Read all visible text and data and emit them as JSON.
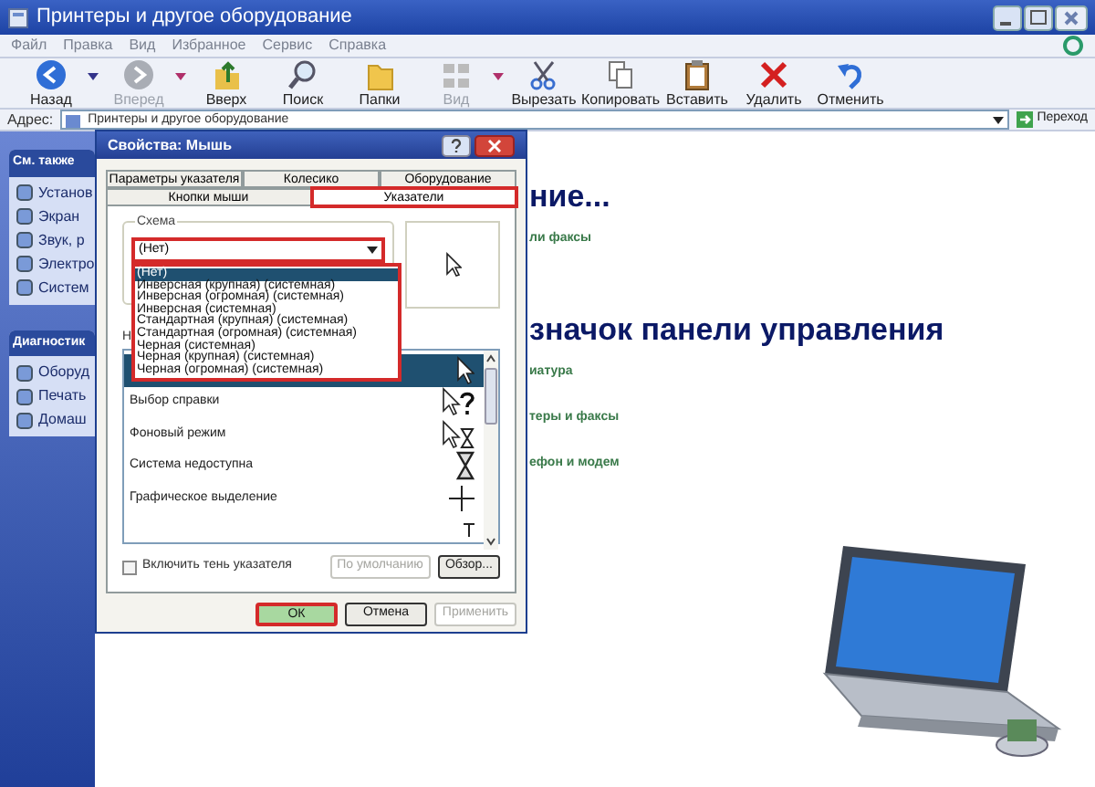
{
  "window": {
    "title": "Принтеры и другое оборудование"
  },
  "menu": [
    "Файл",
    "Правка",
    "Вид",
    "Избранное",
    "Сервис",
    "Справка"
  ],
  "toolbar": [
    {
      "kind": "back",
      "label": "Назад",
      "disabled": false,
      "dropdown": true
    },
    {
      "kind": "forward",
      "label": "Вперед",
      "disabled": true,
      "dropdown": true
    },
    {
      "kind": "up",
      "label": "Вверх",
      "disabled": false,
      "dropdown": false
    },
    {
      "kind": "search",
      "label": "Поиск",
      "disabled": false,
      "dropdown": false
    },
    {
      "kind": "folders",
      "label": "Папки",
      "disabled": false,
      "dropdown": false
    },
    {
      "kind": "view",
      "label": "Вид",
      "disabled": true,
      "dropdown": true
    },
    {
      "kind": "cut",
      "label": "Вырезать",
      "disabled": false,
      "dropdown": false
    },
    {
      "kind": "copy",
      "label": "Копировать",
      "disabled": false,
      "dropdown": false
    },
    {
      "kind": "paste",
      "label": "Вставить",
      "disabled": false,
      "dropdown": false
    },
    {
      "kind": "delete",
      "label": "Удалить",
      "disabled": false,
      "dropdown": false
    },
    {
      "kind": "undo",
      "label": "Отменить",
      "disabled": false,
      "dropdown": false
    }
  ],
  "address": {
    "label": "Адрес:",
    "value": "Принтеры и другое оборудование",
    "go": "Переход"
  },
  "sidebar": [
    {
      "title": "См. также",
      "items": [
        "Установ",
        "Экран",
        "Звук, р",
        "Электро",
        "Систем"
      ]
    },
    {
      "title": "Диагностик",
      "items": [
        "Оборуд",
        "Печать",
        "Домаш"
      ]
    }
  ],
  "content": [
    {
      "kind": "heading",
      "text": "ние..."
    },
    {
      "kind": "link",
      "text": "ли факсы"
    },
    {
      "kind": "heading",
      "text": "значок панели управления"
    },
    {
      "kind": "link",
      "text": "иатура"
    },
    {
      "kind": "link",
      "text": "теры и факсы"
    },
    {
      "kind": "link",
      "text": "ефон и модем"
    }
  ],
  "dialog": {
    "title": "Свойства: Мышь",
    "tab_rows": [
      [
        {
          "label": "Параметры указателя",
          "selected": false
        },
        {
          "label": "Колесико",
          "selected": false
        },
        {
          "label": "Оборудование",
          "selected": false
        }
      ],
      [
        {
          "label": "Кнопки мыши",
          "selected": false
        },
        {
          "label": "Указатели",
          "selected": true
        }
      ]
    ],
    "scheme": {
      "label": "Схема",
      "value": "(Нет)",
      "options": [
        {
          "label": "(Нет)",
          "selected": true
        },
        {
          "label": "Инверсная (крупная) (системная)",
          "selected": false
        },
        {
          "label": "Инверсная (огромная) (системная)",
          "selected": false
        },
        {
          "label": "Инверсная (системная)",
          "selected": false
        },
        {
          "label": "Стандартная (крупная) (системная)",
          "selected": false
        },
        {
          "label": "Стандартная (огромная) (системная)",
          "selected": false
        },
        {
          "label": "Черная  (системная)",
          "selected": false
        },
        {
          "label": "Черная (крупная) (системная)",
          "selected": false
        },
        {
          "label": "Черная (огромная) (системная)",
          "selected": false
        }
      ]
    },
    "list_label": "Н",
    "cursors": [
      {
        "kind": "arrow",
        "selected": true
      },
      {
        "label": "Выбор справки",
        "kind": "help",
        "selected": false
      },
      {
        "label": "Фоновый режим",
        "kind": "busy",
        "selected": false
      },
      {
        "label": "Система недоступна",
        "kind": "hourglass",
        "selected": false
      },
      {
        "label": "Графическое выделение",
        "kind": "cross",
        "selected": false
      },
      {
        "kind": "text",
        "selected": false
      }
    ],
    "shadow": {
      "label": "Включить тень указателя",
      "checked": false
    },
    "side_buttons": [
      {
        "label": "По умолчанию",
        "disabled": true
      },
      {
        "label": "Обзор...",
        "disabled": false
      }
    ],
    "buttons": [
      {
        "label": "ОК",
        "disabled": false,
        "highlighted": true
      },
      {
        "label": "Отмена",
        "disabled": false,
        "highlighted": false
      },
      {
        "label": "Применить",
        "disabled": true,
        "highlighted": false
      }
    ]
  }
}
